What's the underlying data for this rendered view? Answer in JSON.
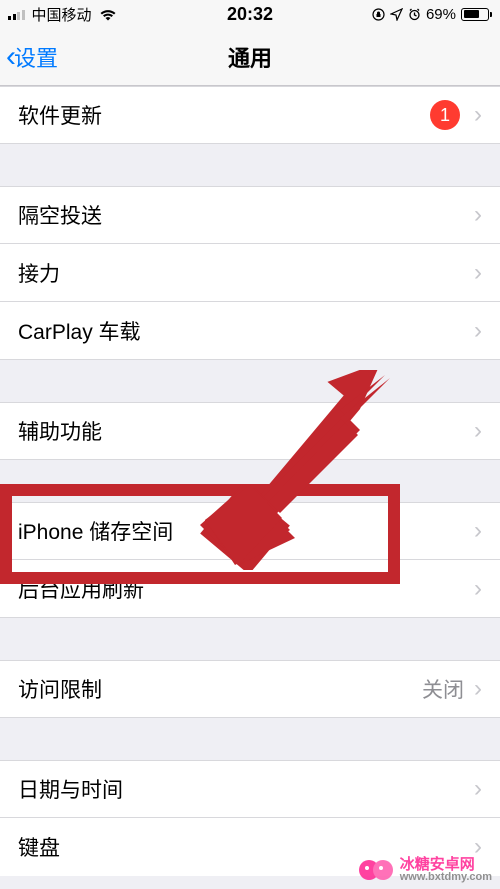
{
  "status": {
    "carrier": "中国移动",
    "time": "20:32",
    "battery_pct": "69%"
  },
  "nav": {
    "back_label": "设置",
    "title": "通用"
  },
  "cells": {
    "software_update": {
      "label": "软件更新",
      "badge": "1"
    },
    "airdrop": {
      "label": "隔空投送"
    },
    "handoff": {
      "label": "接力"
    },
    "carplay": {
      "label": "CarPlay 车载"
    },
    "accessibility": {
      "label": "辅助功能"
    },
    "storage": {
      "label": "iPhone 储存空间"
    },
    "background_refresh": {
      "label": "后台应用刷新"
    },
    "restrictions": {
      "label": "访问限制",
      "value": "关闭"
    },
    "date_time": {
      "label": "日期与时间"
    },
    "keyboard": {
      "label": "键盘"
    }
  },
  "watermark": {
    "name": "冰糖安卓网",
    "url": "www.bxtdmy.com"
  }
}
